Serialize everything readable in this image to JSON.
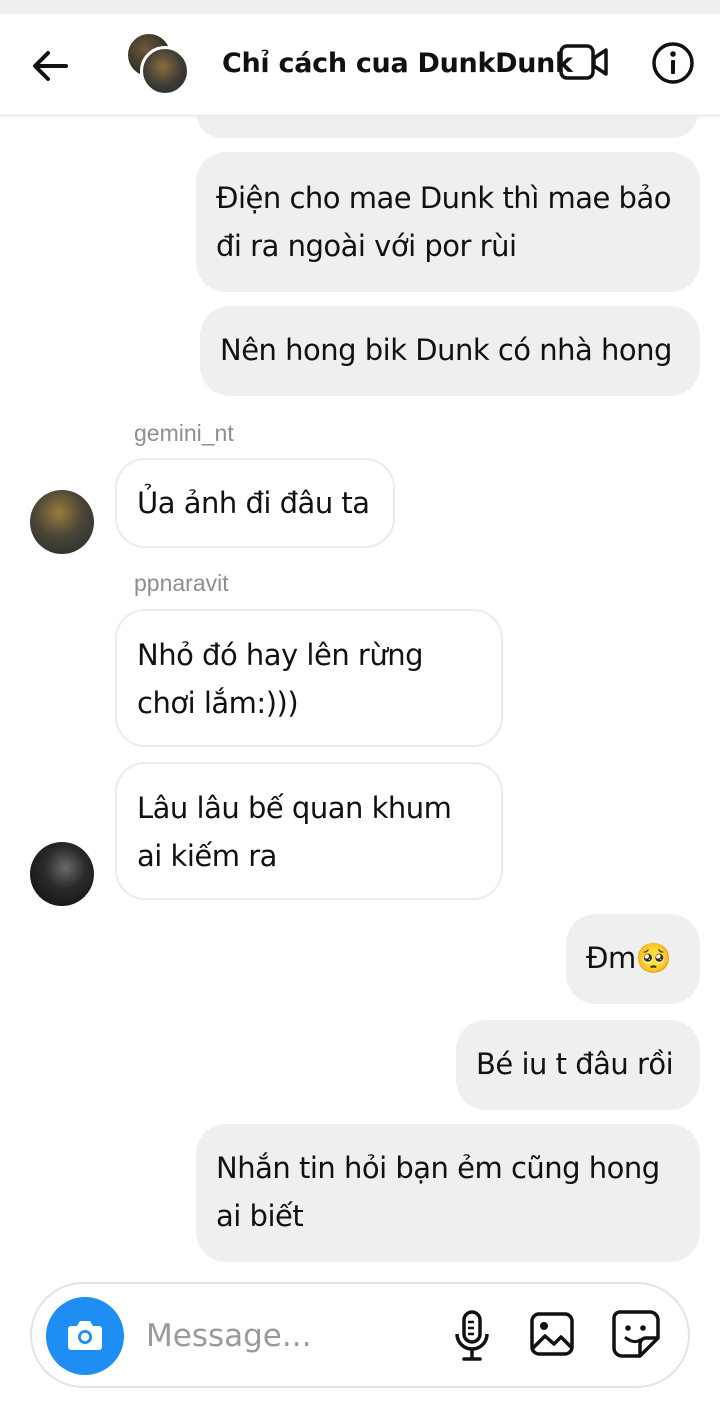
{
  "header": {
    "title": "Chỉ cách cua DunkDunk"
  },
  "messages": {
    "m1": [
      "Điện cho mae Dunk thì mae bảo",
      "đi ra ngoài với por rùi"
    ],
    "m2": [
      "Nên hong bik Dunk có nhà hong"
    ],
    "sender1": "gemini_nt",
    "m3": [
      "Ủa ảnh đi đâu ta"
    ],
    "sender2": "ppnaravit",
    "m4": [
      "Nhỏ đó hay lên rừng",
      "chơi lắm:)))"
    ],
    "m5": [
      "Lâu lâu bế quan khum",
      "ai kiếm ra"
    ],
    "m6": [
      "Đm🥺"
    ],
    "m7": [
      "Bé iu t đâu rồi"
    ],
    "m8": [
      "Nhắn tin hỏi bạn ẻm cũng hong",
      "ai biết"
    ]
  },
  "composer": {
    "placeholder": "Message..."
  },
  "icons": {
    "back": "arrow-left-icon",
    "video": "video-camera-icon",
    "info": "info-icon",
    "camera": "camera-icon",
    "mic": "microphone-icon",
    "gallery": "image-icon",
    "sticker": "sticker-icon"
  },
  "colors": {
    "accent": "#1e8ef5",
    "bubble_out": "#efefef",
    "bubble_in": "#ffffff"
  }
}
